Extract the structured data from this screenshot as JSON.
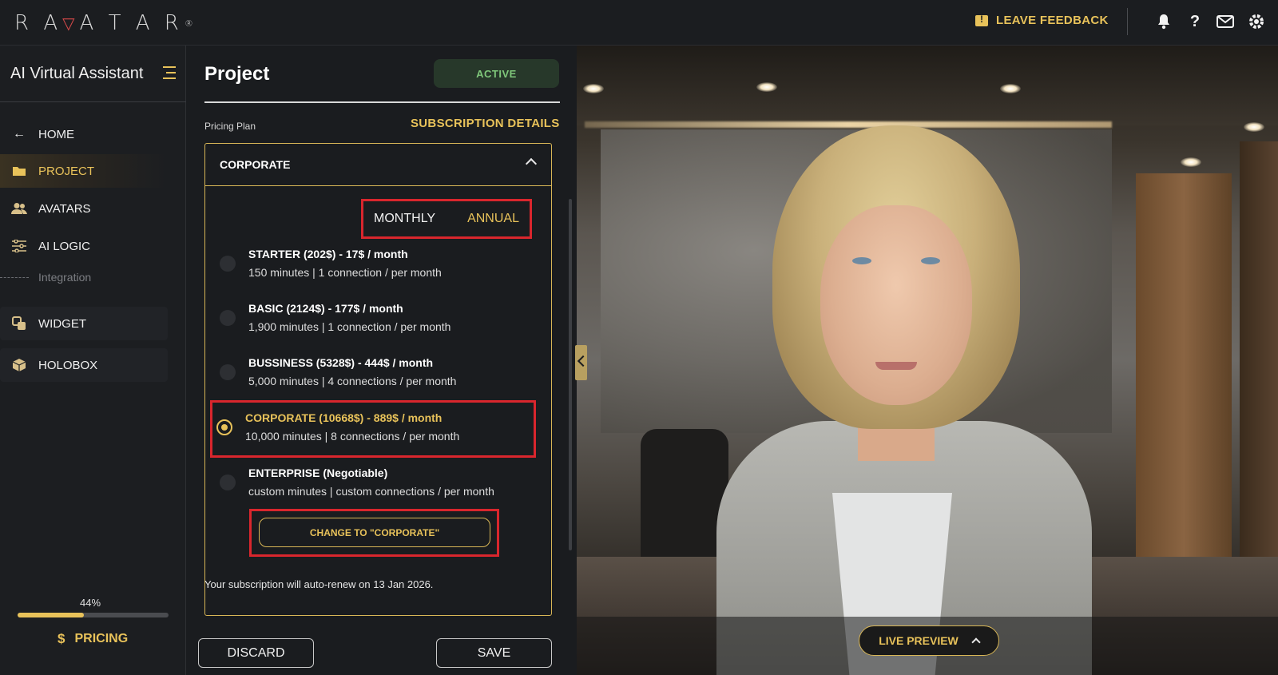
{
  "header": {
    "logo_text": "RAVATAR",
    "feedback_label": "LEAVE FEEDBACK",
    "icons": [
      "bell-icon",
      "help-icon",
      "mail-icon",
      "gear-icon"
    ]
  },
  "sidebar": {
    "title": "AI Virtual Assistant",
    "items": [
      {
        "label": "HOME",
        "icon": "arrow-left-icon"
      },
      {
        "label": "PROJECT",
        "icon": "folder-icon"
      },
      {
        "label": "AVATARS",
        "icon": "users-icon"
      },
      {
        "label": "AI LOGIC",
        "icon": "sliders-icon"
      },
      {
        "label": "Integration",
        "icon": "dashed-line"
      },
      {
        "label": "WIDGET",
        "icon": "widget-icon"
      },
      {
        "label": "HOLOBOX",
        "icon": "box-icon"
      }
    ],
    "progress": {
      "label": "44%",
      "value": 0.44
    },
    "pricing_label": "PRICING"
  },
  "project": {
    "title": "Project",
    "status": "ACTIVE",
    "pricing_plan_label": "Pricing Plan",
    "subscription_details": "SUBSCRIPTION DETAILS",
    "current_plan": "CORPORATE",
    "billing": {
      "monthly": "MONTHLY",
      "annual": "ANNUAL",
      "selected": "ANNUAL"
    },
    "plans": [
      {
        "name": "STARTER (202$) - 17$ / month",
        "desc": "150 minutes | 1 connection / per month",
        "selected": false
      },
      {
        "name": "BASIC (2124$) - 177$ / month",
        "desc": "1,900 minutes | 1 connection / per month",
        "selected": false
      },
      {
        "name": "BUSSINESS (5328$) - 444$ / month",
        "desc": "5,000 minutes | 4 connections / per month",
        "selected": false
      },
      {
        "name": "CORPORATE (10668$) - 889$ / month",
        "desc": "10,000 minutes | 8 connections / per month",
        "selected": true
      },
      {
        "name": "ENTERPRISE (Negotiable)",
        "desc": "custom minutes | custom connections / per month",
        "selected": false
      }
    ],
    "change_button": "CHANGE TO \"CORPORATE\"",
    "renew_text": "Your subscription will auto-renew on 13 Jan 2026.",
    "discard_label": "DISCARD",
    "save_label": "SAVE"
  },
  "preview": {
    "live_preview_label": "LIVE PREVIEW"
  },
  "colors": {
    "accent": "#e8c25a",
    "highlight": "#d9262d",
    "active_status": "#7fc77a"
  }
}
